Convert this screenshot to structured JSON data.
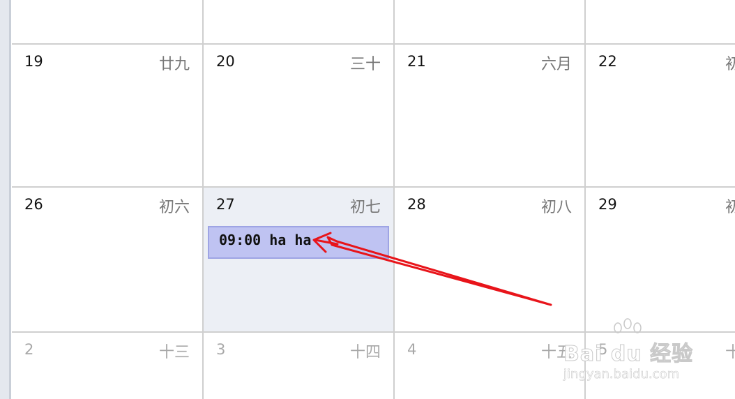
{
  "calendar": {
    "rows": [
      {
        "cells": [
          {
            "day": "",
            "lunar": "",
            "state": "normal"
          },
          {
            "day": "",
            "lunar": "",
            "state": "normal"
          },
          {
            "day": "",
            "lunar": "",
            "state": "normal"
          },
          {
            "day": "",
            "lunar": "",
            "state": "normal"
          }
        ]
      },
      {
        "cells": [
          {
            "day": "19",
            "lunar": "廿九",
            "state": "normal"
          },
          {
            "day": "20",
            "lunar": "三十",
            "state": "normal"
          },
          {
            "day": "21",
            "lunar": "六月",
            "state": "normal"
          },
          {
            "day": "22",
            "lunar": "初",
            "state": "normal"
          }
        ]
      },
      {
        "cells": [
          {
            "day": "26",
            "lunar": "初六",
            "state": "normal"
          },
          {
            "day": "27",
            "lunar": "初七",
            "state": "today"
          },
          {
            "day": "28",
            "lunar": "初八",
            "state": "normal"
          },
          {
            "day": "29",
            "lunar": "初",
            "state": "normal"
          }
        ]
      },
      {
        "cells": [
          {
            "day": "2",
            "lunar": "十三",
            "state": "other"
          },
          {
            "day": "3",
            "lunar": "十四",
            "state": "other"
          },
          {
            "day": "4",
            "lunar": "十五",
            "state": "other"
          },
          {
            "day": "5",
            "lunar": "十",
            "state": "other"
          }
        ]
      }
    ],
    "event": {
      "text": "09:00 ha ha",
      "color": "#bfc3f2",
      "border_color": "#9ea4e4"
    }
  },
  "annotation": {
    "type": "arrow",
    "color": "#e8141a"
  },
  "watermark": {
    "logo": "Bai du 经验",
    "url": "jingyan.baidu.com"
  }
}
